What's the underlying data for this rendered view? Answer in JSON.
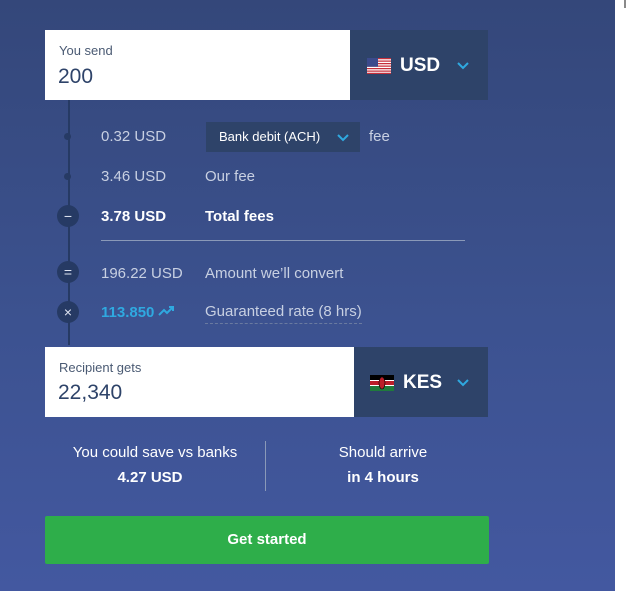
{
  "send": {
    "label": "You send",
    "amount": "200",
    "currency": "USD",
    "flag_icon": "us-flag-icon"
  },
  "fees": {
    "method_amount": "0.32 USD",
    "method_select": "Bank debit (ACH)",
    "method_suffix": "fee",
    "our_fee_amount": "3.46 USD",
    "our_fee_label": "Our fee",
    "total_amount": "3.78 USD",
    "total_label": "Total fees",
    "total_symbol": "−",
    "convert_amount": "196.22 USD",
    "convert_label": "Amount we’ll convert",
    "convert_symbol": "=",
    "rate_value": "113.850",
    "rate_label": "Guaranteed rate (8 hrs)",
    "rate_symbol": "×"
  },
  "receive": {
    "label": "Recipient gets",
    "amount": "22,340",
    "currency": "KES",
    "flag_icon": "kenya-flag-icon"
  },
  "savings": {
    "label": "You could save vs banks",
    "amount": "4.27 USD"
  },
  "arrival": {
    "label": "Should arrive",
    "time": "in 4 hours"
  },
  "cta": {
    "label": "Get started"
  },
  "colors": {
    "background": "#3c5290",
    "dark_box": "#2e4369",
    "accent_blue": "#2fa9e0",
    "cta_green": "#2eae4a"
  }
}
